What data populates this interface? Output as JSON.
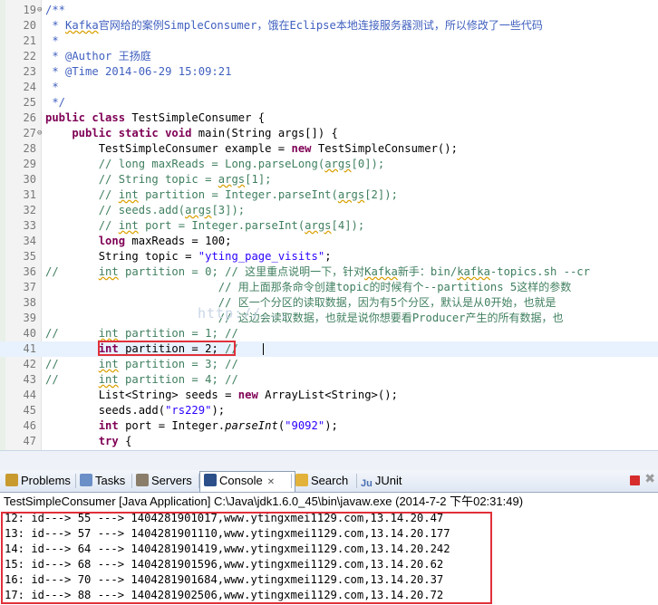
{
  "editor": {
    "lines": [
      {
        "n": "19",
        "fold": "⊖",
        "segs": [
          {
            "c": "doc",
            "t": "/**"
          }
        ]
      },
      {
        "n": "20",
        "segs": [
          {
            "c": "doc",
            "t": " * "
          },
          {
            "c": "doc wavy",
            "t": "Kafka"
          },
          {
            "c": "doc cjk",
            "t": "官网给的案例"
          },
          {
            "c": "doc",
            "t": "SimpleConsumer"
          },
          {
            "c": "doc cjk",
            "t": "，饿在"
          },
          {
            "c": "doc",
            "t": "Eclipse"
          },
          {
            "c": "doc cjk",
            "t": "本地连接服务器测试，所以修改了一些代码"
          }
        ]
      },
      {
        "n": "21",
        "segs": [
          {
            "c": "doc",
            "t": " *"
          }
        ]
      },
      {
        "n": "22",
        "segs": [
          {
            "c": "doc",
            "t": " * @Author "
          },
          {
            "c": "doc cjk",
            "t": "王扬庭"
          }
        ]
      },
      {
        "n": "23",
        "segs": [
          {
            "c": "doc",
            "t": " * @Time 2014-06-29 15:09:21"
          }
        ]
      },
      {
        "n": "24",
        "segs": [
          {
            "c": "doc",
            "t": " *"
          }
        ]
      },
      {
        "n": "25",
        "segs": [
          {
            "c": "doc",
            "t": " */"
          }
        ]
      },
      {
        "n": "26",
        "segs": [
          {
            "c": "kw",
            "t": "public class "
          },
          {
            "c": "",
            "t": "TestSimpleConsumer {"
          }
        ]
      },
      {
        "n": "27",
        "fold": "⊖",
        "segs": [
          {
            "c": "kw",
            "t": "    public static void "
          },
          {
            "c": "",
            "t": "main(String args[]) {"
          }
        ]
      },
      {
        "n": "28",
        "segs": [
          {
            "c": "",
            "t": "        TestSimpleConsumer example = "
          },
          {
            "c": "kw",
            "t": "new "
          },
          {
            "c": "",
            "t": "TestSimpleConsumer();"
          }
        ]
      },
      {
        "n": "29",
        "segs": [
          {
            "c": "cmt",
            "t": "        // long maxReads = Long.parseLong("
          },
          {
            "c": "cmt wavy",
            "t": "args"
          },
          {
            "c": "cmt",
            "t": "[0]);"
          }
        ]
      },
      {
        "n": "30",
        "segs": [
          {
            "c": "cmt",
            "t": "        // String topic = "
          },
          {
            "c": "cmt wavy",
            "t": "args"
          },
          {
            "c": "cmt",
            "t": "[1];"
          }
        ]
      },
      {
        "n": "31",
        "segs": [
          {
            "c": "cmt",
            "t": "        // "
          },
          {
            "c": "cmt wavy",
            "t": "int"
          },
          {
            "c": "cmt",
            "t": " partition = Integer.parseInt("
          },
          {
            "c": "cmt wavy",
            "t": "args"
          },
          {
            "c": "cmt",
            "t": "[2]);"
          }
        ]
      },
      {
        "n": "32",
        "segs": [
          {
            "c": "cmt",
            "t": "        // seeds.add("
          },
          {
            "c": "cmt wavy",
            "t": "args"
          },
          {
            "c": "cmt",
            "t": "[3]);"
          }
        ]
      },
      {
        "n": "33",
        "segs": [
          {
            "c": "cmt",
            "t": "        // "
          },
          {
            "c": "cmt wavy",
            "t": "int"
          },
          {
            "c": "cmt",
            "t": " port = Integer.parseInt("
          },
          {
            "c": "cmt wavy",
            "t": "args"
          },
          {
            "c": "cmt",
            "t": "[4]);"
          }
        ]
      },
      {
        "n": "34",
        "segs": [
          {
            "c": "kw",
            "t": "        long "
          },
          {
            "c": "",
            "t": "maxReads = 100;"
          }
        ]
      },
      {
        "n": "35",
        "segs": [
          {
            "c": "",
            "t": "        String topic = "
          },
          {
            "c": "str",
            "t": "\"yting_page_visits\""
          },
          {
            "c": "",
            "t": ";"
          }
        ]
      },
      {
        "n": "36",
        "segs": [
          {
            "c": "cmt",
            "t": "//      "
          },
          {
            "c": "cmt wavy",
            "t": "int"
          },
          {
            "c": "cmt",
            "t": " partition = 0; // "
          },
          {
            "c": "cmt cjk",
            "t": "这里重点说明一下，针对"
          },
          {
            "c": "cmt wavy",
            "t": "Kafka"
          },
          {
            "c": "cmt cjk",
            "t": "新手："
          },
          {
            "c": "cmt",
            "t": "bin/"
          },
          {
            "c": "cmt wavy",
            "t": "kafka"
          },
          {
            "c": "cmt",
            "t": "-topics.sh --cr"
          }
        ]
      },
      {
        "n": "37",
        "segs": [
          {
            "c": "cmt",
            "t": "                          // "
          },
          {
            "c": "cmt cjk",
            "t": "用上面那条命令创建"
          },
          {
            "c": "cmt",
            "t": "topic"
          },
          {
            "c": "cmt cjk",
            "t": "的时候有个"
          },
          {
            "c": "cmt",
            "t": "--partitions 5"
          },
          {
            "c": "cmt cjk",
            "t": "这样的参数"
          }
        ]
      },
      {
        "n": "38",
        "segs": [
          {
            "c": "cmt",
            "t": "                          // "
          },
          {
            "c": "cmt cjk",
            "t": "区一个分区的读取数据，因为有"
          },
          {
            "c": "cmt",
            "t": "5"
          },
          {
            "c": "cmt cjk",
            "t": "个分区，默认是从"
          },
          {
            "c": "cmt",
            "t": "0"
          },
          {
            "c": "cmt cjk",
            "t": "开始，也就是"
          }
        ]
      },
      {
        "n": "39",
        "segs": [
          {
            "c": "cmt",
            "t": "                          // "
          },
          {
            "c": "cmt cjk",
            "t": "这边会读取数据，也就是说你想要看"
          },
          {
            "c": "cmt",
            "t": "Producer"
          },
          {
            "c": "cmt cjk",
            "t": "产生的所有数据，也"
          }
        ]
      },
      {
        "n": "40",
        "segs": [
          {
            "c": "cmt",
            "t": "//      "
          },
          {
            "c": "cmt wavy",
            "t": "int"
          },
          {
            "c": "cmt",
            "t": " partition = 1; //"
          }
        ]
      },
      {
        "n": "41",
        "current": true,
        "box": true,
        "segs": [
          {
            "c": "kw",
            "t": "        int "
          },
          {
            "c": "",
            "t": "partition = 2;"
          },
          {
            "c": "cmt",
            "t": " //"
          }
        ]
      },
      {
        "n": "42",
        "segs": [
          {
            "c": "cmt",
            "t": "//      "
          },
          {
            "c": "cmt wavy",
            "t": "int"
          },
          {
            "c": "cmt",
            "t": " partition = 3; //"
          }
        ]
      },
      {
        "n": "43",
        "segs": [
          {
            "c": "cmt",
            "t": "//      "
          },
          {
            "c": "cmt wavy",
            "t": "int"
          },
          {
            "c": "cmt",
            "t": " partition = 4; //"
          }
        ]
      },
      {
        "n": "44",
        "segs": [
          {
            "c": "",
            "t": "        List<String> seeds = "
          },
          {
            "c": "kw",
            "t": "new "
          },
          {
            "c": "",
            "t": "ArrayList<String>();"
          }
        ]
      },
      {
        "n": "45",
        "segs": [
          {
            "c": "",
            "t": "        seeds.add("
          },
          {
            "c": "str",
            "t": "\"rs229\""
          },
          {
            "c": "",
            "t": ");"
          }
        ]
      },
      {
        "n": "46",
        "segs": [
          {
            "c": "kw",
            "t": "        int "
          },
          {
            "c": "",
            "t": "port = Integer."
          },
          {
            "c": "it",
            "t": "parseInt"
          },
          {
            "c": "",
            "t": "("
          },
          {
            "c": "str",
            "t": "\"9092\""
          },
          {
            "c": "",
            "t": ");"
          }
        ]
      },
      {
        "n": "47",
        "segs": [
          {
            "c": "kw",
            "t": "        try "
          },
          {
            "c": "",
            "t": "{"
          }
        ]
      }
    ],
    "watermark": "http://..."
  },
  "tabs": [
    {
      "label": "Problems",
      "icon": "problems-icon",
      "color": "#c99a2e"
    },
    {
      "label": "Tasks",
      "icon": "tasks-icon",
      "color": "#6b8fc7"
    },
    {
      "label": "Servers",
      "icon": "servers-icon",
      "color": "#8a7e6a"
    },
    {
      "label": "Console",
      "icon": "console-icon",
      "color": "#2c4f8a",
      "active": true,
      "close": "✕"
    },
    {
      "label": "Search",
      "icon": "search-icon",
      "color": "#e2b23a"
    },
    {
      "label": "JUnit",
      "icon": "junit-icon",
      "color": "#4a6fb0",
      "prefix": "Ju"
    }
  ],
  "console": {
    "header": "TestSimpleConsumer [Java Application] C:\\Java\\jdk1.6.0_45\\bin\\javaw.exe (2014-7-2 下午02:31:49)",
    "lines": [
      "12: id---> 55 ---> 1404281901017,www.ytingxmei1129.com,13.14.20.47",
      "13: id---> 57 ---> 1404281901110,www.ytingxmei1129.com,13.14.20.177",
      "14: id---> 64 ---> 1404281901419,www.ytingxmei1129.com,13.14.20.242",
      "15: id---> 68 ---> 1404281901596,www.ytingxmei1129.com,13.14.20.62",
      "16: id---> 70 ---> 1404281901684,www.ytingxmei1129.com,13.14.20.37",
      "17: id---> 88 ---> 1404281902506,www.ytingxmei1129.com,13.14.20.72"
    ]
  },
  "colors": {
    "highlight_box": "#e0303a",
    "current_line": "#e8f2fe",
    "keyword": "#7f0055",
    "comment": "#3f7f5f",
    "javadoc": "#3f5fbf",
    "string": "#2a00ff"
  }
}
